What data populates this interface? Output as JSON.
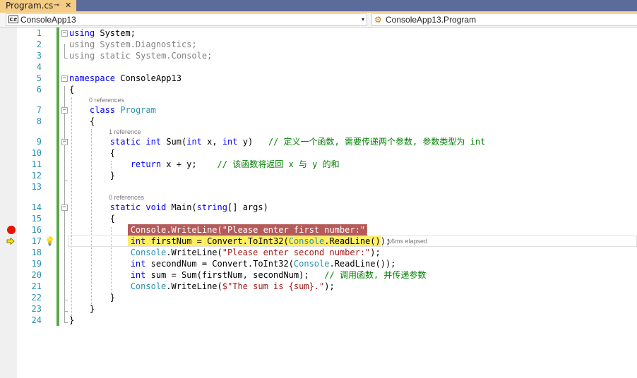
{
  "tab": {
    "title": "Program.cs",
    "pin_glyph": "⊸",
    "close_glyph": "✕"
  },
  "navbar": {
    "project": "ConsoleApp13",
    "project_icon": "C#",
    "member": "ConsoleApp13.Program",
    "dropdown_arrow": "▾"
  },
  "code_lens": {
    "program_refs": "0 references",
    "sum_refs": "1 reference",
    "main_refs": "0 references"
  },
  "perf_tip": "≤6ms elapsed",
  "lines": [
    {
      "n": "1"
    },
    {
      "n": "2"
    },
    {
      "n": "3"
    },
    {
      "n": "4"
    },
    {
      "n": "5"
    },
    {
      "n": "6"
    },
    {
      "n": "7"
    },
    {
      "n": "8"
    },
    {
      "n": "9"
    },
    {
      "n": "10"
    },
    {
      "n": "11"
    },
    {
      "n": "12"
    },
    {
      "n": "13"
    },
    {
      "n": "14"
    },
    {
      "n": "15"
    },
    {
      "n": "16"
    },
    {
      "n": "17"
    },
    {
      "n": "18"
    },
    {
      "n": "19"
    },
    {
      "n": "20"
    },
    {
      "n": "21"
    },
    {
      "n": "22"
    },
    {
      "n": "23"
    },
    {
      "n": "24"
    }
  ],
  "src": {
    "using": "using",
    "system": "System;",
    "diag": "System.Diagnostics;",
    "static": "static",
    "system_dot": "System.",
    "console_cls": "Console",
    "semicolon": ";",
    "namespace": "namespace",
    "ns_name": "ConsoleApp13",
    "open_brace": "{",
    "close_brace": "}",
    "class": "class",
    "program": "Program",
    "int": "int",
    "sum_sig1": "Sum(",
    "sum_sig2": " x, ",
    "sum_sig3": " y)   ",
    "sum_comment": "// 定义一个函数, 需要传递两个参数, 参数类型为 int",
    "return": "return",
    "return_expr": " x + y;    ",
    "return_comment": "// 该函数将返回 x 与 y 的和",
    "void": "void",
    "main_sig": "Main(",
    "string": "string",
    "main_args": "[] args)",
    "console": "Console",
    "writeline1": ".WriteLine(",
    "str1": "\"Please enter first number:\"",
    "close_paren_semi": ");",
    "first_decl": " firstNum = Convert.ToInt32(",
    "readline": ".ReadLine());",
    "str2": "\"Please enter second number:\"",
    "second_decl": " secondNum = Convert.ToInt32(",
    "sum_decl": " sum = Sum(firstNum, secondNum);   ",
    "sum_decl_comment": "// 调用函数, 并传递参数",
    "writeline_pre": ".WriteLine(",
    "str3": "$\"The sum is {sum}.\"",
    "close3": ");"
  },
  "colors": {
    "keyword": "#0000ff",
    "type": "#2b91af",
    "string": "#a31515",
    "comment": "#008000",
    "breakpoint": "#e51400",
    "exec_highlight": "#ffee62",
    "tab_active": "#f5cc84"
  },
  "icons": [
    "breakpoint-icon",
    "execution-arrow-icon",
    "lightbulb-icon",
    "csharp-project-icon",
    "class-icon"
  ]
}
